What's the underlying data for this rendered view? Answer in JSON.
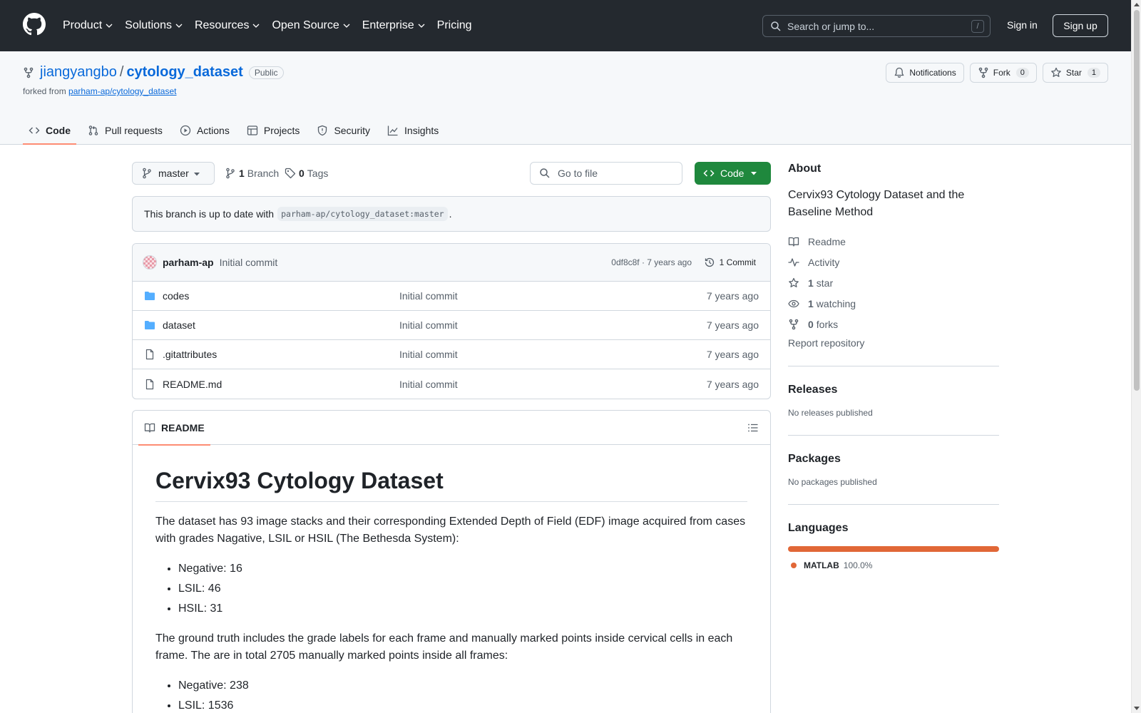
{
  "header": {
    "nav": [
      "Product",
      "Solutions",
      "Resources",
      "Open Source",
      "Enterprise",
      "Pricing"
    ],
    "search_placeholder": "Search or jump to...",
    "search_key": "/",
    "signin": "Sign in",
    "signup": "Sign up"
  },
  "repo": {
    "owner": "jiangyangbo",
    "separator": "/",
    "name": "cytology_dataset",
    "visibility": "Public",
    "forked_from_prefix": "forked from",
    "forked_from": "parham-ap/cytology_dataset",
    "notifications": "Notifications",
    "fork_label": "Fork",
    "fork_count": "0",
    "star_label": "Star",
    "star_count": "1",
    "tabs": [
      "Code",
      "Pull requests",
      "Actions",
      "Projects",
      "Security",
      "Insights"
    ]
  },
  "toolbar": {
    "branch": "master",
    "branch_count": "1",
    "branch_label": "Branch",
    "tag_count": "0",
    "tag_label": "Tags",
    "goto_placeholder": "Go to file",
    "code_button": "Code"
  },
  "status": {
    "text": "This branch is up to date with",
    "ref": "parham-ap/cytology_dataset:master",
    "suffix": "."
  },
  "latest_commit": {
    "author": "parham-ap",
    "message": "Initial commit",
    "meta": "0df8c8f · 7 years ago",
    "count": "1 Commit"
  },
  "files": [
    {
      "name": "codes",
      "type": "folder",
      "message": "Initial commit",
      "date": "7 years ago"
    },
    {
      "name": "dataset",
      "type": "folder",
      "message": "Initial commit",
      "date": "7 years ago"
    },
    {
      "name": ".gitattributes",
      "type": "file",
      "message": "Initial commit",
      "date": "7 years ago"
    },
    {
      "name": "README.md",
      "type": "file",
      "message": "Initial commit",
      "date": "7 years ago"
    }
  ],
  "readme": {
    "tab": "README",
    "title": "Cervix93 Cytology Dataset",
    "p1": "The dataset has 93 image stacks and their corresponding Extended Depth of Field (EDF) image acquired from cases with grades Nagative, LSIL or HSIL (The Bethesda System):",
    "list1": [
      "Negative: 16",
      "LSIL: 46",
      "HSIL: 31"
    ],
    "p2": "The ground truth includes the grade labels for each frame and manually marked points inside cervical cells in each frame. The are in total 2705 manually marked points inside all frames:",
    "list2": [
      "Negative: 238",
      "LSIL: 1536"
    ]
  },
  "about": {
    "heading": "About",
    "description": "Cervix93 Cytology Dataset and the Baseline Method",
    "readme": "Readme",
    "activity": "Activity",
    "stars_count": "1",
    "stars_label": "star",
    "watching_count": "1",
    "watching_label": "watching",
    "forks_count": "0",
    "forks_label": "forks",
    "report": "Report repository"
  },
  "releases": {
    "heading": "Releases",
    "text": "No releases published"
  },
  "packages": {
    "heading": "Packages",
    "text": "No packages published"
  },
  "languages": {
    "heading": "Languages",
    "items": [
      {
        "name": "MATLAB",
        "percent": "100.0%",
        "fraction": 1.0,
        "color": "#e16737"
      }
    ]
  }
}
